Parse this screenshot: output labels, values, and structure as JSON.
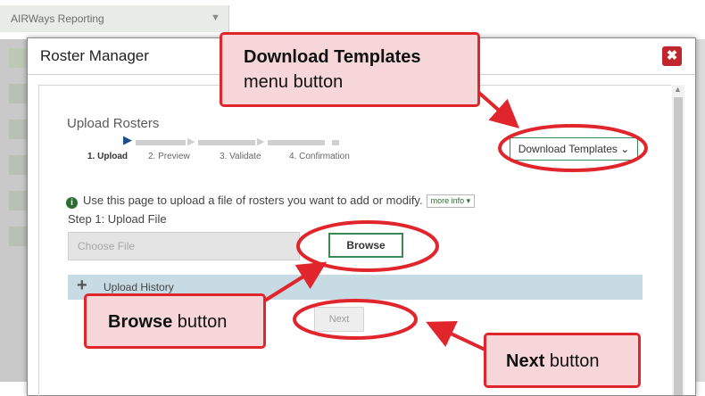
{
  "app": {
    "selector_label": "AIRWays Reporting"
  },
  "modal": {
    "title": "Roster Manager",
    "close_glyph": "✖",
    "section_title": "Upload Rosters",
    "steps": [
      {
        "label": "1. Upload",
        "active": true
      },
      {
        "label": "2. Preview",
        "active": false
      },
      {
        "label": "3. Validate",
        "active": false
      },
      {
        "label": "4. Confirmation",
        "active": false
      }
    ],
    "download_templates_label": "Download Templates",
    "info_text": "Use this page to upload a file of rosters you want to add or modify.",
    "more_info_label": "more info",
    "step1_label": "Step 1: Upload File",
    "file_placeholder": "Choose File",
    "browse_label": "Browse",
    "upload_history_label": "Upload History",
    "next_label": "Next"
  },
  "annotations": {
    "download_title": "Download Templates",
    "download_sub": "menu button",
    "browse_bold": "Browse",
    "browse_rest": " button",
    "next_bold": "Next",
    "next_rest": " button",
    "highlight_color": "#e0262c",
    "callout_fill": "#f6d6d8"
  },
  "colors": {
    "accent_green": "#3a8a57",
    "close_red": "#c0262d",
    "history_bar": "#c7dbe4"
  }
}
